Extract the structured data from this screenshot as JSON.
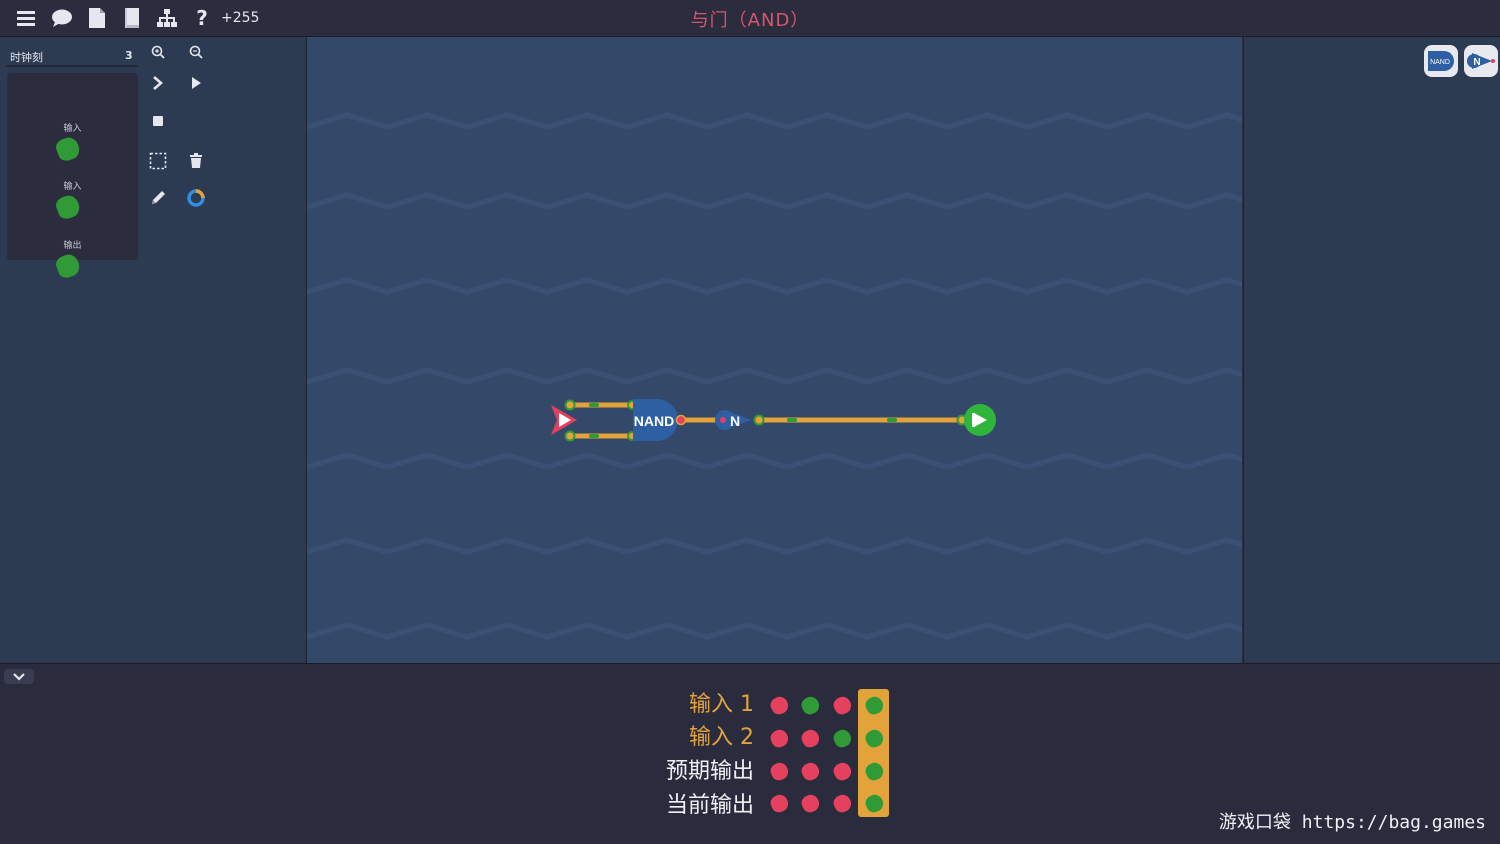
{
  "topbar": {
    "icons": [
      "menu-icon",
      "chat-icon",
      "file-icon",
      "book-icon",
      "hierarchy-icon",
      "help-icon"
    ],
    "help_glyph": "?",
    "score": "+255",
    "title": "与门（AND）"
  },
  "left_panel": {
    "clock_label": "时钟刻",
    "clock_value": "3",
    "io_items": [
      {
        "label": "输入",
        "state": "on"
      },
      {
        "label": "输入",
        "state": "on"
      },
      {
        "label": "输出",
        "state": "on"
      }
    ],
    "tools": [
      "zoom-in-icon",
      "zoom-out-icon",
      "step-icon",
      "play-icon",
      "stop-icon",
      "select-icon",
      "delete-icon",
      "pencil-icon",
      "color-icon"
    ]
  },
  "canvas": {
    "nand_label": "NAND",
    "not_label": "N"
  },
  "right_panel": {
    "chips": [
      {
        "label": "NAND",
        "icon": "nand-chip-icon"
      },
      {
        "label": "N",
        "icon": "not-chip-icon"
      }
    ]
  },
  "truth_table": {
    "rows": [
      {
        "label": "输入 1",
        "color": "#e3a33b",
        "values": [
          0,
          1,
          0,
          1
        ]
      },
      {
        "label": "输入 2",
        "color": "#e3a33b",
        "values": [
          0,
          0,
          1,
          1
        ]
      },
      {
        "label": "预期输出",
        "color": "#f0f0f4",
        "values": [
          0,
          0,
          0,
          1
        ]
      },
      {
        "label": "当前输出",
        "color": "#f0f0f4",
        "values": [
          0,
          0,
          0,
          1
        ]
      }
    ],
    "highlight_column": 3,
    "colors": {
      "off": "#e5405e",
      "on": "#2f9a36"
    }
  },
  "watermark": {
    "cn": "游戏口袋",
    "url": "https://bag.games"
  },
  "colors": {
    "wire": "#e3a33b",
    "gate": "#2d5fa2",
    "input_pin": "#e5405e",
    "output_pin": "#2fb53a",
    "title": "#d9556e"
  }
}
